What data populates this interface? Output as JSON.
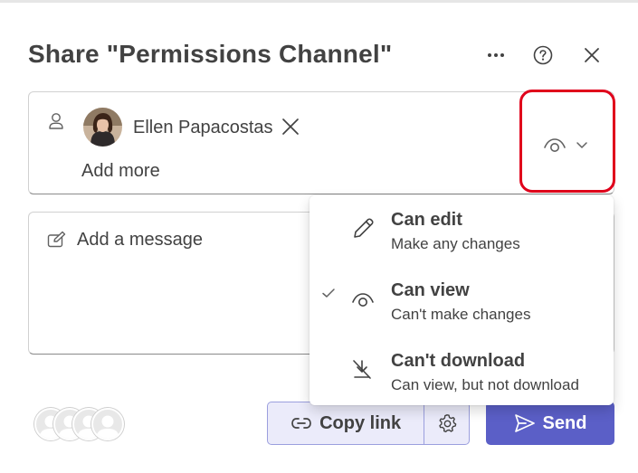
{
  "dialog": {
    "title": "Share \"Permissions Channel\"",
    "more_icon": "more-horizontal-icon",
    "help_icon": "help-circle-icon",
    "close_icon": "close-icon"
  },
  "recipients": {
    "person_icon": "person-icon",
    "people": [
      {
        "name": "Ellen Papacostas",
        "avatar": "photo",
        "remove_icon": "dismiss-icon"
      }
    ],
    "add_more_placeholder": "Add more",
    "permission": {
      "current": "Can view",
      "icon": "eye-icon",
      "chevron_icon": "chevron-down-icon"
    }
  },
  "message": {
    "icon": "compose-icon",
    "placeholder": "Add a message"
  },
  "permissions_menu": {
    "items": [
      {
        "title": "Can edit",
        "description": "Make any changes",
        "icon": "pencil-icon",
        "selected": false
      },
      {
        "title": "Can view",
        "description": "Can't make changes",
        "icon": "eye-icon",
        "selected": true
      },
      {
        "title": "Can't download",
        "description": "Can view, but not download",
        "icon": "no-download-icon",
        "selected": false
      }
    ]
  },
  "footer": {
    "shared_with_avatars": 4,
    "copy_link_label": "Copy link",
    "copy_link_icon": "link-icon",
    "settings_icon": "gear-icon",
    "send_label": "Send",
    "send_icon": "send-icon"
  },
  "colors": {
    "primary": "#5b5fc7",
    "copy_bg": "#ebebfa",
    "highlight": "#e0001b",
    "text": "#424242"
  }
}
